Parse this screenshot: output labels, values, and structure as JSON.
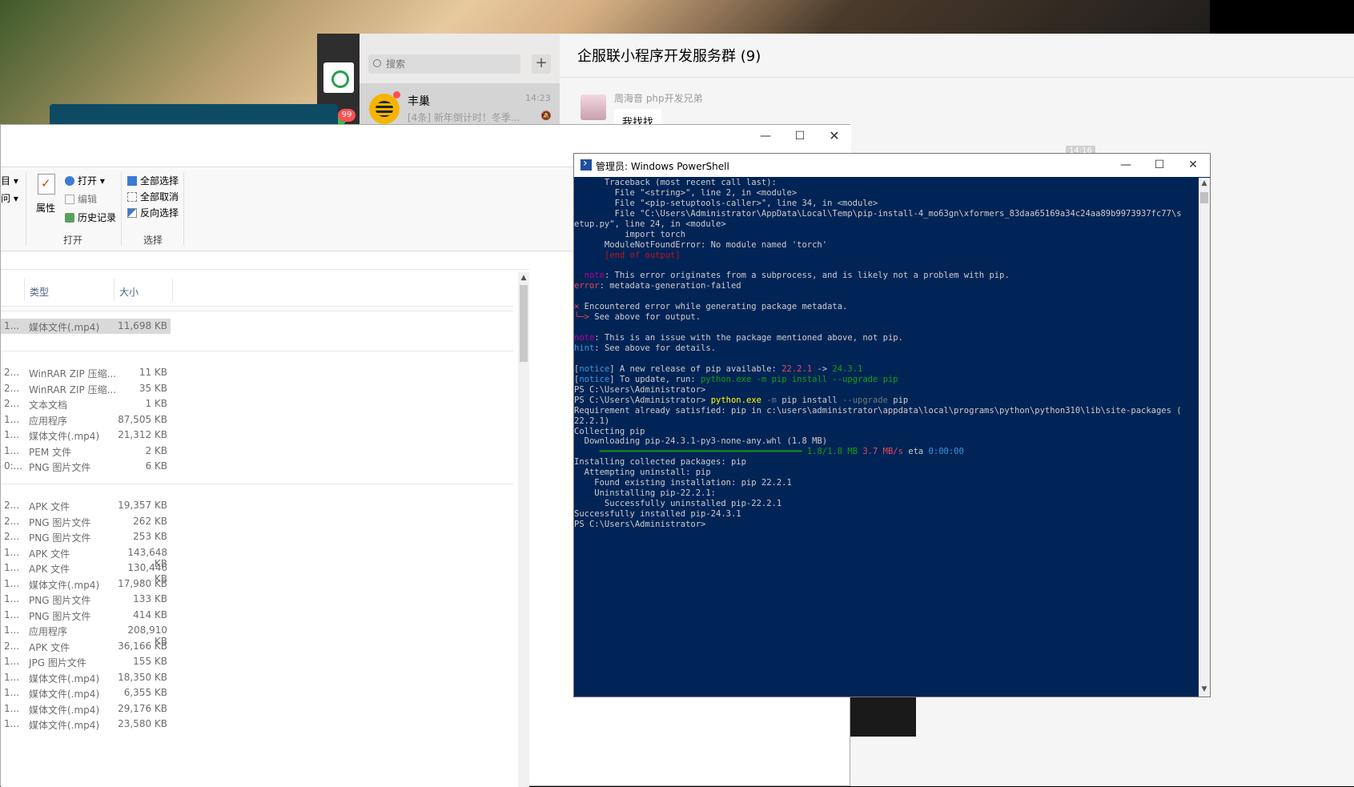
{
  "wechat": {
    "search_placeholder": "搜索",
    "plus_label": "+",
    "unread_badge": "99",
    "conversation": {
      "name": "丰巢",
      "time": "14:23",
      "preview": "[4条] 新年倒计时！冬季...",
      "mute_icon": "bell-mute-icon"
    },
    "chat_title": "企服联小程序开发服务群 (9)",
    "sender_name": "周海音 php开发兄弟",
    "message": "我找找",
    "timestamp_fragment": "14:16"
  },
  "explorer": {
    "caption": {
      "min": "—",
      "max": "☐",
      "close": "✕"
    },
    "ribbon": {
      "fragment_1": "目 ▾",
      "fragment_2": "问 ▾",
      "properties": "属性",
      "open": "打开 ▾",
      "edit": "编辑",
      "history": "历史记录",
      "group_open": "打开",
      "select_all": "全部选择",
      "select_none": "全部取消",
      "select_invert": "反向选择",
      "group_select": "选择"
    },
    "columns": {
      "type": "类型",
      "size": "大小"
    },
    "group_1": [
      {
        "c1": "1...",
        "type": "媒体文件(.mp4)",
        "size": "11,698 KB"
      }
    ],
    "group_2": [
      {
        "c1": "2...",
        "type": "WinRAR ZIP 压缩...",
        "size": "11 KB"
      },
      {
        "c1": "2...",
        "type": "WinRAR ZIP 压缩...",
        "size": "35 KB"
      },
      {
        "c1": "2...",
        "type": "文本文档",
        "size": "1 KB"
      },
      {
        "c1": "1...",
        "type": "应用程序",
        "size": "87,505 KB"
      },
      {
        "c1": "1...",
        "type": "媒体文件(.mp4)",
        "size": "21,312 KB"
      },
      {
        "c1": "1...",
        "type": "PEM 文件",
        "size": "2 KB"
      },
      {
        "c1": "0:...",
        "type": "PNG 图片文件",
        "size": "6 KB"
      }
    ],
    "group_3": [
      {
        "c1": "2...",
        "type": "APK 文件",
        "size": "19,357 KB"
      },
      {
        "c1": "2...",
        "type": "PNG 图片文件",
        "size": "262 KB"
      },
      {
        "c1": "2...",
        "type": "PNG 图片文件",
        "size": "253 KB"
      },
      {
        "c1": "1...",
        "type": "APK 文件",
        "size": "143,648 KB"
      },
      {
        "c1": "1...",
        "type": "APK 文件",
        "size": "130,446 KB"
      },
      {
        "c1": "1...",
        "type": "媒体文件(.mp4)",
        "size": "17,980 KB"
      },
      {
        "c1": "1...",
        "type": "PNG 图片文件",
        "size": "133 KB"
      },
      {
        "c1": "1...",
        "type": "PNG 图片文件",
        "size": "414 KB"
      },
      {
        "c1": "1...",
        "type": "应用程序",
        "size": "208,910 KB"
      },
      {
        "c1": "2...",
        "type": "APK 文件",
        "size": "36,166 KB"
      },
      {
        "c1": "1...",
        "type": "JPG 图片文件",
        "size": "155 KB"
      },
      {
        "c1": "1...",
        "type": "媒体文件(.mp4)",
        "size": "18,350 KB"
      },
      {
        "c1": "1...",
        "type": "媒体文件(.mp4)",
        "size": "6,355 KB"
      },
      {
        "c1": "1...",
        "type": "媒体文件(.mp4)",
        "size": "29,176 KB"
      },
      {
        "c1": "1...",
        "type": "媒体文件(.mp4)",
        "size": "23,580 KB"
      }
    ]
  },
  "powershell": {
    "title": "管理员: Windows PowerShell",
    "caption": {
      "min": "—",
      "max": "☐",
      "close": "✕"
    },
    "lines": [
      [
        {
          "t": "      Traceback (most recent call last):"
        }
      ],
      [
        {
          "t": "        File \"<string>\", line 2, in <module>"
        }
      ],
      [
        {
          "t": "        File \"<pip-setuptools-caller>\", line 34, in <module>"
        }
      ],
      [
        {
          "t": "        File \"C:\\Users\\Administrator\\AppData\\Local\\Temp\\pip-install-4_mo63gn\\xformers_83daa65169a34c24aa89b9973937fc77\\s"
        }
      ],
      [
        {
          "t": "etup.py\", line 24, in <module>"
        }
      ],
      [
        {
          "t": "          import torch"
        }
      ],
      [
        {
          "t": "      ModuleNotFoundError: No module named 'torch'"
        }
      ],
      [
        {
          "t": "      ",
          "c": ""
        },
        {
          "t": "[end of output]",
          "c": "dr"
        }
      ],
      [
        {
          "t": ""
        }
      ],
      [
        {
          "t": "  "
        },
        {
          "t": "note",
          "c": "m"
        },
        {
          "t": ": This error originates from a subprocess, and is likely not a problem with pip."
        }
      ],
      [
        {
          "t": "error",
          "c": "r"
        },
        {
          "t": ": metadata-generation-failed"
        }
      ],
      [
        {
          "t": ""
        }
      ],
      [
        {
          "t": "×",
          "c": "r"
        },
        {
          "t": " Encountered error while generating package metadata."
        }
      ],
      [
        {
          "t": "╰─>",
          "c": "r"
        },
        {
          "t": " See above for output."
        }
      ],
      [
        {
          "t": ""
        }
      ],
      [
        {
          "t": "note",
          "c": "m"
        },
        {
          "t": ": This is an issue with the package mentioned above, not pip."
        }
      ],
      [
        {
          "t": "hint",
          "c": "c"
        },
        {
          "t": ": See above for details."
        }
      ],
      [
        {
          "t": ""
        }
      ],
      [
        {
          "t": "["
        },
        {
          "t": "notice",
          "c": "c"
        },
        {
          "t": "] A new release of pip available: "
        },
        {
          "t": "22.2.1",
          "c": "r"
        },
        {
          "t": " -> "
        },
        {
          "t": "24.3.1",
          "c": "g"
        }
      ],
      [
        {
          "t": "["
        },
        {
          "t": "notice",
          "c": "c"
        },
        {
          "t": "] To update, run: "
        },
        {
          "t": "python.exe -m pip install --upgrade pip",
          "c": "g"
        }
      ],
      [
        {
          "t": "PS C:\\Users\\Administrator>"
        }
      ],
      [
        {
          "t": "PS C:\\Users\\Administrator> "
        },
        {
          "t": "python.exe",
          "c": "y"
        },
        {
          "t": " -m",
          "c": "gr"
        },
        {
          "t": " pip install "
        },
        {
          "t": "--upgrade",
          "c": "gr"
        },
        {
          "t": " pip"
        }
      ],
      [
        {
          "t": "Requirement already satisfied: pip in c:\\users\\administrator\\appdata\\local\\programs\\python\\python310\\lib\\site-packages ("
        }
      ],
      [
        {
          "t": "22.2.1)"
        }
      ],
      [
        {
          "t": "Collecting pip"
        }
      ],
      [
        {
          "t": "  Downloading pip-24.3.1-py3-none-any.whl (1.8 MB)"
        }
      ],
      [
        {
          "t": "     ━━━━━━━━━━━━━━━━━━━━━━━━━━━━━━━━━━━━━━━━",
          "c": "g"
        },
        {
          "t": " 1.8/1.8 MB",
          "c": "g"
        },
        {
          "t": " 3.7 MB/s",
          "c": "r"
        },
        {
          "t": " eta "
        },
        {
          "t": "0:00:00",
          "c": "c"
        }
      ],
      [
        {
          "t": "Installing collected packages: pip"
        }
      ],
      [
        {
          "t": "  Attempting uninstall: pip"
        }
      ],
      [
        {
          "t": "    Found existing installation: pip 22.2.1"
        }
      ],
      [
        {
          "t": "    Uninstalling pip-22.2.1:"
        }
      ],
      [
        {
          "t": "      Successfully uninstalled pip-22.2.1"
        }
      ],
      [
        {
          "t": "Successfully installed pip-24.3.1"
        }
      ],
      [
        {
          "t": "PS C:\\Users\\Administrator>"
        }
      ]
    ]
  }
}
